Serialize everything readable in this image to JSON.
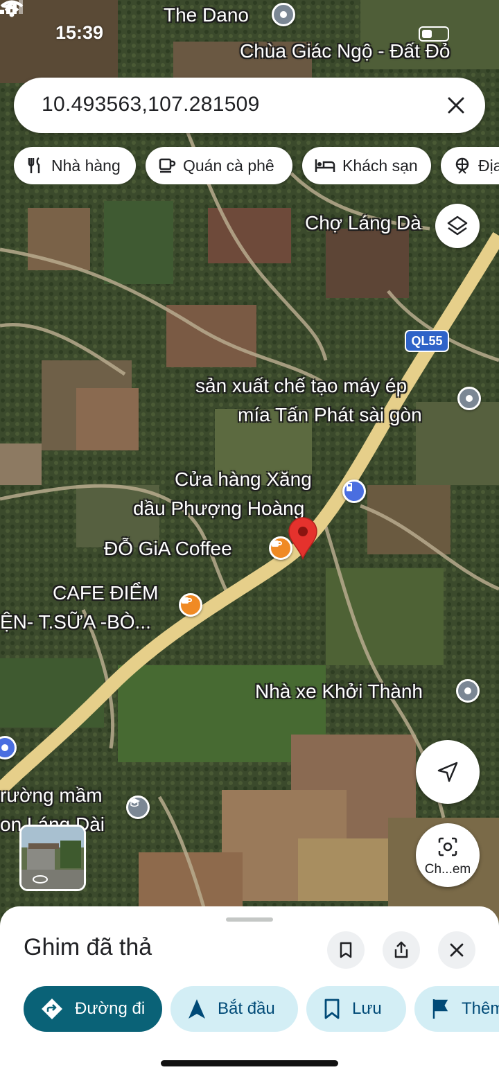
{
  "status_bar": {
    "time": "15:39"
  },
  "search": {
    "query": "10.493563,107.281509"
  },
  "chips": [
    {
      "label": "Nhà hàng",
      "icon": "fork-knife-icon"
    },
    {
      "label": "Quán cà phê",
      "icon": "coffee-cup-icon"
    },
    {
      "label": "Khách sạn",
      "icon": "bed-icon"
    },
    {
      "label": "Địa",
      "icon": "attraction-icon"
    }
  ],
  "map_labels": {
    "the_dano": "The Dano",
    "chua_giac_ngo": "Chùa Giác Ngộ - Đất Đỏ",
    "cho_lang_dai": "Chợ Láng Dà",
    "road_badge": "QL55",
    "tan_phat_line1": "sản xuất chế tạo máy ép",
    "tan_phat_line2": "mía Tấn Phát sài gòn",
    "xang_line1": "Cửa hàng Xăng",
    "xang_line2": "dầu Phượng Hoàng",
    "do_gia": "ĐỖ GiA Coffee",
    "cafe_diem_line1": "CAFE ĐIỂM",
    "cafe_diem_line2": "ỆN- T.SỮA -BÒ...",
    "nha_xe": "Nhà xe Khởi Thành",
    "truong_line1": "rường mầm",
    "truong_line2": "on Láng Dài"
  },
  "lens_button": {
    "label": "Ch...em"
  },
  "sheet": {
    "title": "Ghim đã thả",
    "actions": [
      {
        "label": "Đường đi",
        "icon": "directions-icon"
      },
      {
        "label": "Bắt đầu",
        "icon": "navigation-arrow-icon"
      },
      {
        "label": "Lưu",
        "icon": "bookmark-icon"
      },
      {
        "label": "Thêm",
        "icon": "flag-icon"
      }
    ]
  },
  "colors": {
    "road": "#e6cf8a",
    "pin_red": "#e5322d",
    "poi_orange": "#f08a24",
    "primary_button": "#0a6277",
    "secondary_button": "#d3eef5"
  }
}
